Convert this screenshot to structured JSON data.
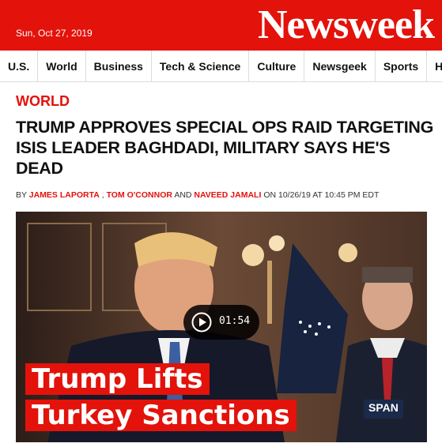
{
  "header": {
    "date": "Sun, Oct 27, 2019",
    "logo": "Newsweek",
    "brand_color": "#e3120b"
  },
  "nav": {
    "items": [
      "U.S.",
      "World",
      "Business",
      "Tech & Science",
      "Culture",
      "Newsgeek",
      "Sports",
      "Health"
    ]
  },
  "article": {
    "section": "WORLD",
    "headline": "TRUMP APPROVES SPECIAL OPS RAID TARGETING ISIS LEADER BAGHDADI, MILITARY SAYS HE'S DEAD",
    "byline": {
      "prefix": "BY",
      "author1": "JAMES LAPORTA",
      "sep1": ",",
      "author2": "TOM O'CONNOR",
      "and": "AND",
      "author3": "NAVEED JAMALI",
      "on": "ON",
      "datetime": "10/26/19 AT 10:45 PM EDT"
    }
  },
  "video": {
    "duration": "01:54",
    "overlay_line1": "Trump Lifts",
    "overlay_line2": "Turkey Sanctions",
    "network_bug": "SPAN",
    "play_icon": "play-icon"
  }
}
